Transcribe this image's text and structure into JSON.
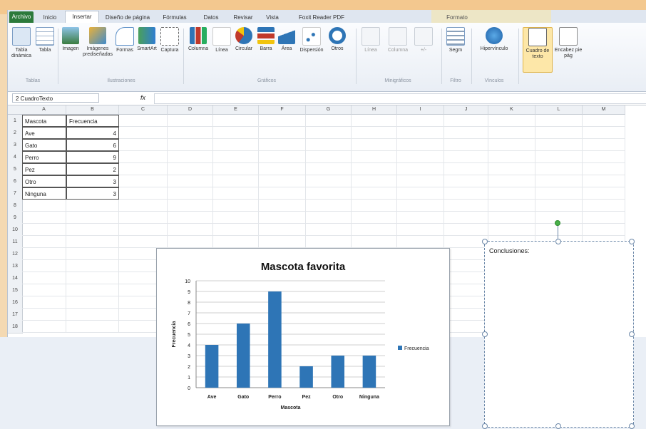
{
  "tabs": [
    "Archivo",
    "Inicio",
    "Insertar",
    "Diseño de página",
    "Fórmulas",
    "Datos",
    "Revisar",
    "Vista",
    "Foxit Reader PDF",
    "Formato"
  ],
  "ribbon": {
    "tablas": {
      "items": [
        "Tabla dinámica",
        "Tabla"
      ],
      "group": "Tablas"
    },
    "ilustraciones": {
      "items": [
        "Imagen",
        "Imágenes prediseñadas",
        "Formas",
        "SmartArt",
        "Captura"
      ],
      "group": "Ilustraciones"
    },
    "graficos": {
      "items": [
        "Columna",
        "Línea",
        "Circular",
        "Barra",
        "Área",
        "Dispersión",
        "Otros"
      ],
      "group": "Gráficos"
    },
    "minigraficos": {
      "items": [
        "Línea",
        "Columna",
        "+/-"
      ],
      "group": "Minigráficos"
    },
    "filtro": {
      "items": [
        "Segm"
      ],
      "group": "Filtro"
    },
    "vinculos": {
      "items": [
        "Hipervínculo"
      ],
      "group": "Vínculos"
    },
    "texto": {
      "items": [
        "Cuadro de texto",
        "Encabez pie pág"
      ]
    }
  },
  "formula_bar": {
    "name_box": "2 CuadroTexto",
    "fx": "fx",
    "value": ""
  },
  "columns": [
    "A",
    "B",
    "C",
    "D",
    "E",
    "F",
    "G",
    "H",
    "I",
    "J",
    "K",
    "L",
    "M"
  ],
  "rows": [
    "1",
    "2",
    "3",
    "4",
    "5",
    "6",
    "7",
    "8",
    "9",
    "10",
    "11",
    "12",
    "13",
    "14",
    "15",
    "16",
    "17",
    "18"
  ],
  "table": {
    "header": [
      "Mascota",
      "Frecuencia"
    ],
    "rows": [
      [
        "Ave",
        "4"
      ],
      [
        "Gato",
        "6"
      ],
      [
        "Perro",
        "9"
      ],
      [
        "Pez",
        "2"
      ],
      [
        "Otro",
        "3"
      ],
      [
        "Ninguna",
        "3"
      ]
    ]
  },
  "textbox": {
    "text": "Conclusiones:"
  },
  "chart_data": {
    "type": "bar",
    "title": "Mascota favorita",
    "xlabel": "Mascota",
    "ylabel": "Frecuencia",
    "categories": [
      "Ave",
      "Gato",
      "Perro",
      "Pez",
      "Otro",
      "Ninguna"
    ],
    "series": [
      {
        "name": "Frecuencia",
        "values": [
          4,
          6,
          9,
          2,
          3,
          3
        ]
      }
    ],
    "ylim": [
      0,
      10
    ],
    "yticks": [
      0,
      1,
      2,
      3,
      4,
      5,
      6,
      7,
      8,
      9,
      10
    ],
    "grid": true,
    "legend": "right",
    "bar_color": "#2e75b6"
  }
}
